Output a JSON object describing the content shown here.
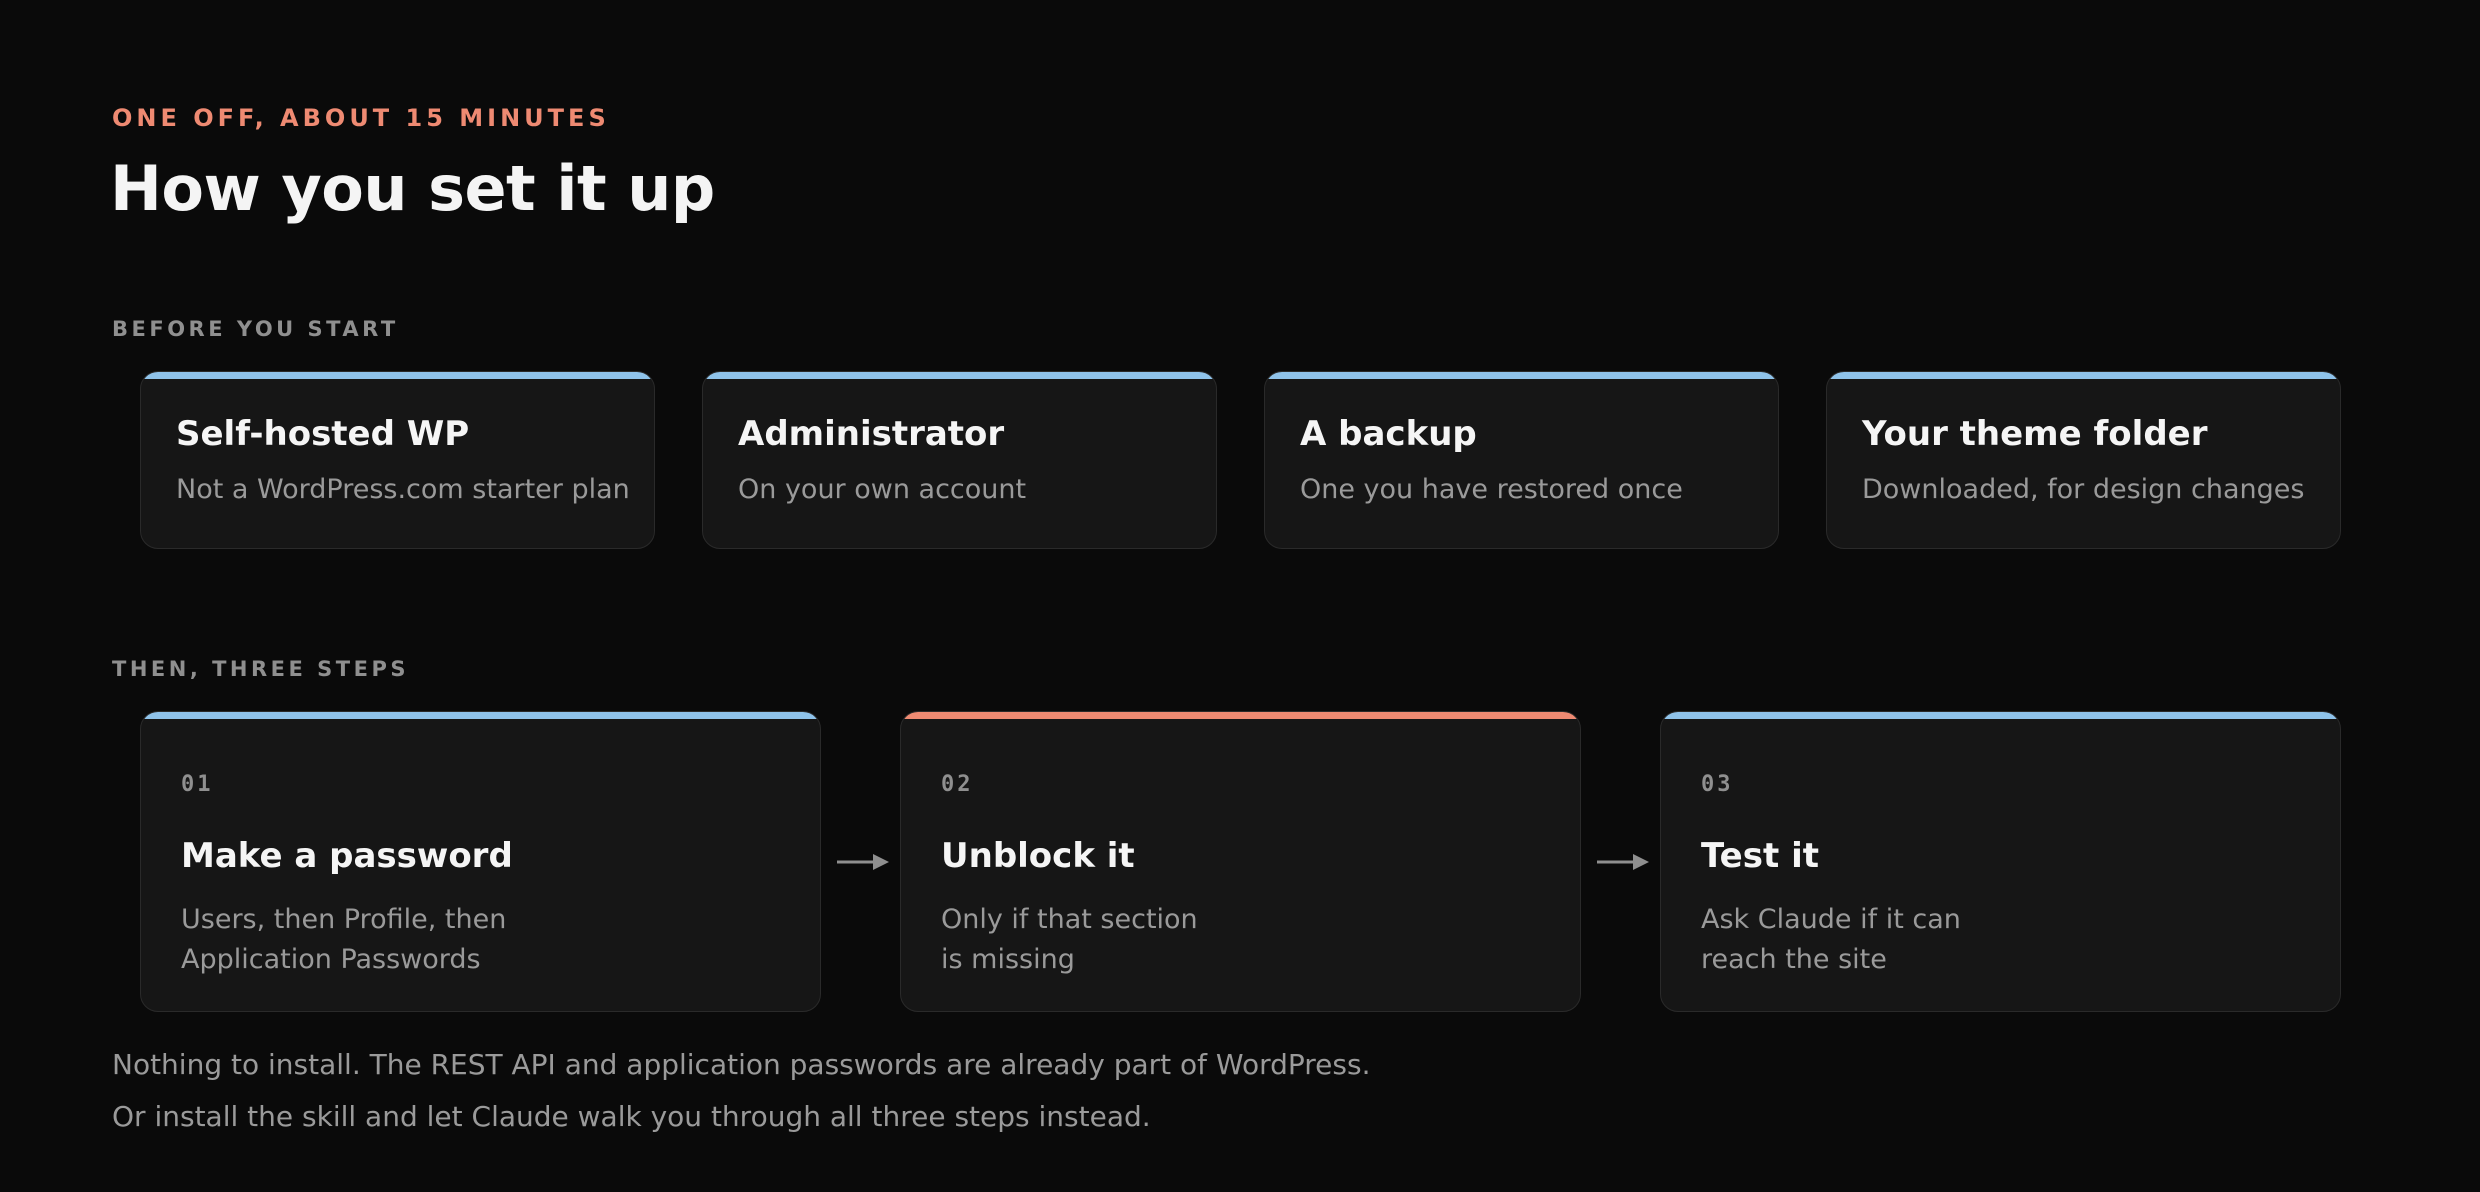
{
  "header": {
    "eyebrow": "ONE OFF, ABOUT 15 MINUTES",
    "title": "How you set it up"
  },
  "before": {
    "label": "BEFORE YOU START",
    "cards": [
      {
        "title": "Self-hosted WP",
        "subtitle": "Not a WordPress.com starter plan"
      },
      {
        "title": "Administrator",
        "subtitle": "On your own account"
      },
      {
        "title": "A backup",
        "subtitle": "One you have restored once"
      },
      {
        "title": "Your theme folder",
        "subtitle": "Downloaded, for design changes"
      }
    ]
  },
  "steps": {
    "label": "THEN, THREE STEPS",
    "items": [
      {
        "number": "01",
        "title": "Make a password",
        "desc_line1": "Users, then Profile, then",
        "desc_line2": "Application Passwords"
      },
      {
        "number": "02",
        "title": "Unblock it",
        "desc_line1": "Only if that section",
        "desc_line2": "is missing"
      },
      {
        "number": "03",
        "title": "Test it",
        "desc_line1": "Ask Claude if it can",
        "desc_line2": "reach the site"
      }
    ]
  },
  "footer": {
    "line1": "Nothing to install. The REST API and application passwords are already part of WordPress.",
    "line2": "Or install the skill and let Claude walk you through all three steps instead."
  },
  "colors": {
    "accent_blue": "#8fc3ea",
    "accent_coral": "#ee8a72",
    "background": "#0a0a0a",
    "card": "#161616"
  },
  "icons": {
    "step_connector": "arrow-right-icon"
  }
}
